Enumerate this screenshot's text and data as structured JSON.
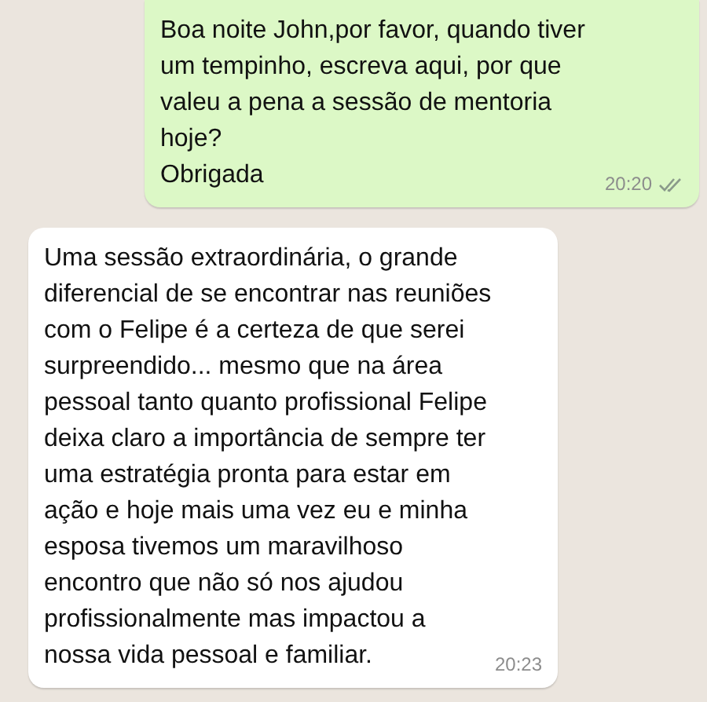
{
  "messages": [
    {
      "kind": "outgoing",
      "lines": [
        "Boa noite John,por favor, quando tiver",
        "um tempinho, escreva aqui, por que",
        "valeu a pena a sessão de mentoria",
        "hoje?",
        "Obrigada"
      ],
      "time": "20:20",
      "read": false
    },
    {
      "kind": "incoming",
      "lines": [
        "Uma sessão extraordinária, o grande",
        "diferencial de se encontrar nas reuniões",
        "com o Felipe é a certeza de que serei",
        "surpreendido... mesmo que na área",
        "pessoal tanto quanto profissional Felipe",
        "deixa claro a importância de sempre ter",
        "uma estratégia pronta para estar em",
        "ação e hoje mais uma vez eu e minha",
        "esposa tivemos um maravilhoso",
        "encontro que não só nos ajudou",
        "profissionalmente mas impactou a",
        "nossa vida pessoal e familiar."
      ],
      "time": "20:23"
    }
  ]
}
